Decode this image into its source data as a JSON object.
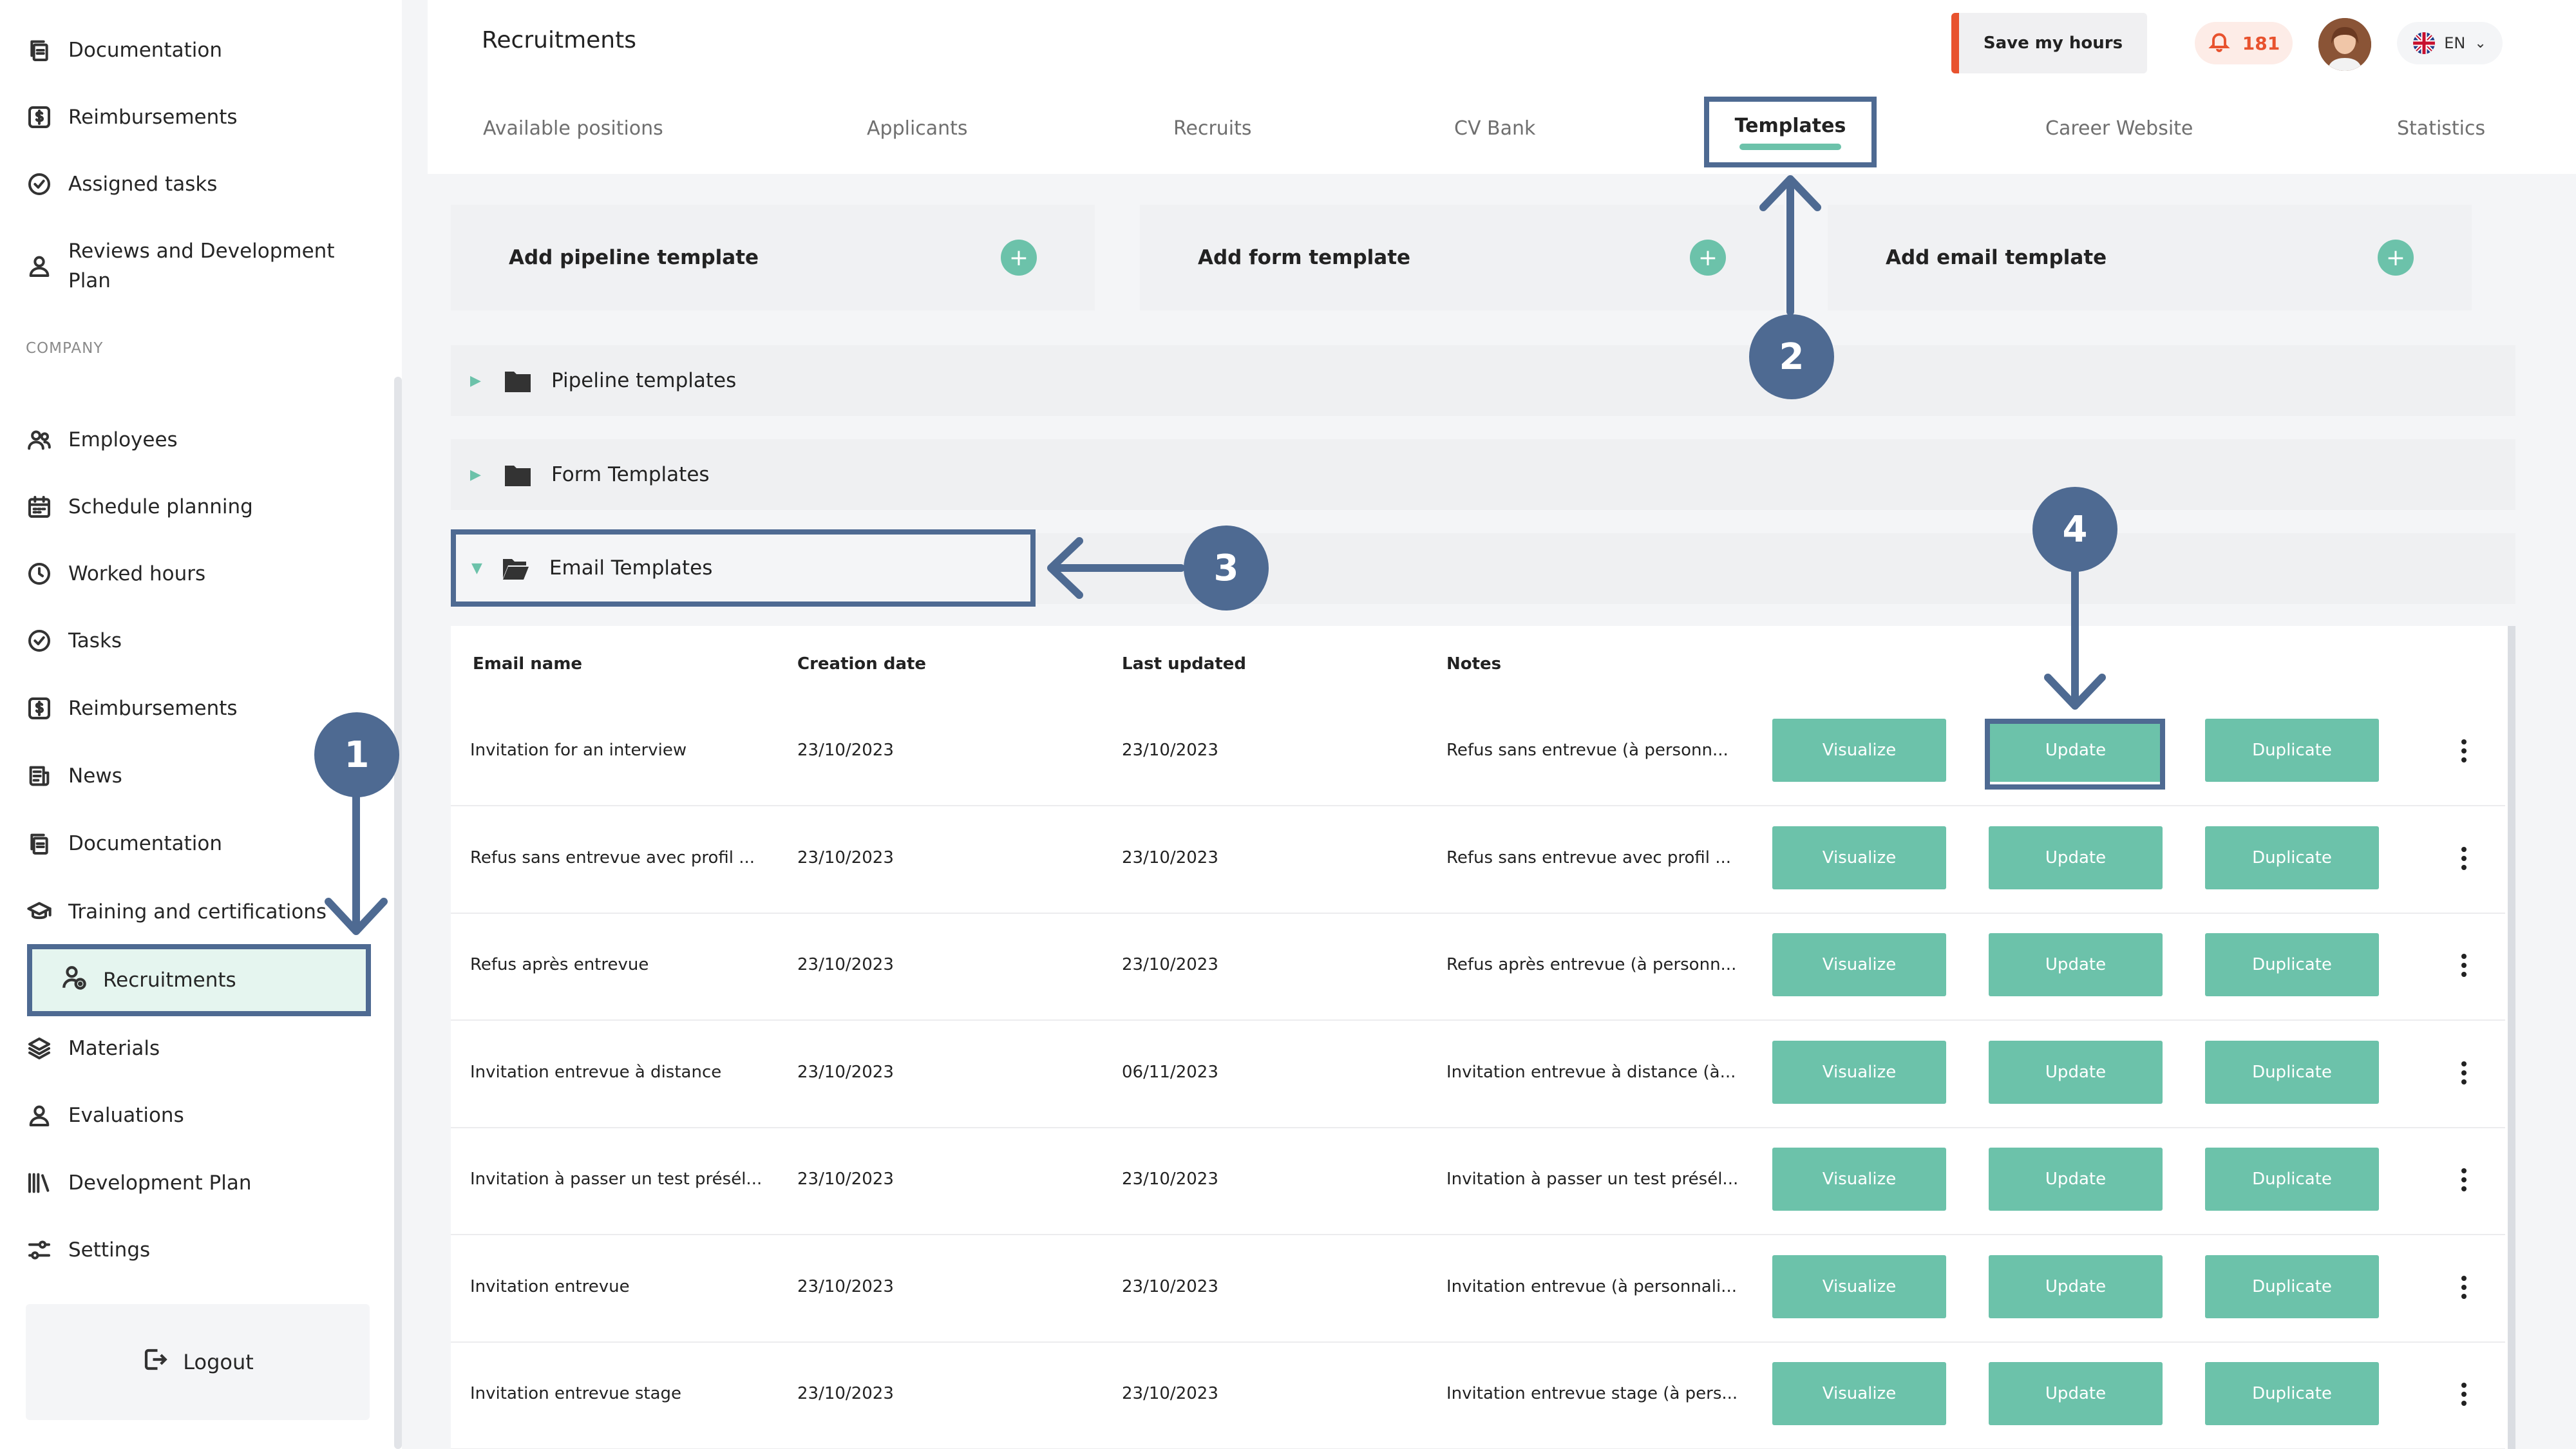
{
  "sidebar": {
    "top_items": [
      {
        "label": "Documentation",
        "icon": "documents-icon"
      },
      {
        "label": "Reimbursements",
        "icon": "dollar-icon"
      },
      {
        "label": "Assigned tasks",
        "icon": "check-circle-icon"
      },
      {
        "label": "Reviews and Development Plan",
        "icon": "person-icon"
      }
    ],
    "section_label": "COMPANY",
    "company_items": [
      {
        "label": "Employees",
        "icon": "users-icon"
      },
      {
        "label": "Schedule planning",
        "icon": "calendar-icon"
      },
      {
        "label": "Worked hours",
        "icon": "clock-icon"
      },
      {
        "label": "Tasks",
        "icon": "check-circle-icon"
      },
      {
        "label": "Reimbursements",
        "icon": "dollar-icon"
      },
      {
        "label": "News",
        "icon": "news-icon"
      },
      {
        "label": "Documentation",
        "icon": "documents-icon"
      },
      {
        "label": "Training and certifications",
        "icon": "graduation-cap-icon"
      },
      {
        "label": "Recruitments",
        "icon": "user-add-icon"
      },
      {
        "label": "Materials",
        "icon": "layers-icon"
      },
      {
        "label": "Evaluations",
        "icon": "person-icon"
      },
      {
        "label": "Development Plan",
        "icon": "bars-icon"
      },
      {
        "label": "Settings",
        "icon": "sliders-icon"
      }
    ],
    "logout_label": "Logout"
  },
  "header": {
    "title": "Recruitments",
    "save_hours_label": "Save my hours",
    "notification_count": "181",
    "language": "EN"
  },
  "tabs": [
    {
      "label": "Available positions"
    },
    {
      "label": "Applicants"
    },
    {
      "label": "Recruits"
    },
    {
      "label": "CV Bank"
    },
    {
      "label": "Templates",
      "active": true
    },
    {
      "label": "Career Website"
    },
    {
      "label": "Statistics"
    }
  ],
  "add_cards": [
    {
      "label": "Add pipeline template"
    },
    {
      "label": "Add form template"
    },
    {
      "label": "Add email template"
    }
  ],
  "folders": [
    {
      "label": "Pipeline templates",
      "expanded": false
    },
    {
      "label": "Form Templates",
      "expanded": false
    },
    {
      "label": "Email Templates",
      "expanded": true
    }
  ],
  "table": {
    "columns": [
      "Email name",
      "Creation date",
      "Last updated",
      "Notes"
    ],
    "actions": {
      "visualize": "Visualize",
      "update": "Update",
      "duplicate": "Duplicate"
    },
    "rows": [
      {
        "name": "Invitation for an interview",
        "created": "23/10/2023",
        "updated": "23/10/2023",
        "notes": "Refus sans entrevue (à personn..."
      },
      {
        "name": "Refus sans entrevue avec profil ...",
        "created": "23/10/2023",
        "updated": "23/10/2023",
        "notes": "Refus sans entrevue avec profil ..."
      },
      {
        "name": "Refus après entrevue",
        "created": "23/10/2023",
        "updated": "23/10/2023",
        "notes": "Refus après entrevue (à personn..."
      },
      {
        "name": "Invitation entrevue à distance",
        "created": "23/10/2023",
        "updated": "06/11/2023",
        "notes": "Invitation entrevue à distance (à..."
      },
      {
        "name": "Invitation à passer un test présél...",
        "created": "23/10/2023",
        "updated": "23/10/2023",
        "notes": "Invitation à passer un test présél..."
      },
      {
        "name": "Invitation entrevue",
        "created": "23/10/2023",
        "updated": "23/10/2023",
        "notes": "Invitation entrevue (à personnali..."
      },
      {
        "name": "Invitation entrevue stage",
        "created": "23/10/2023",
        "updated": "23/10/2023",
        "notes": "Invitation entrevue stage (à pers..."
      }
    ]
  },
  "annotations": [
    "1",
    "2",
    "3",
    "4"
  ],
  "colors": {
    "accent": "#6cc2aa",
    "annotation": "#4e6a92",
    "alert": "#e8522e",
    "highlight_bg": "#e5f5ef",
    "page_bg": "#f4f5f7"
  }
}
